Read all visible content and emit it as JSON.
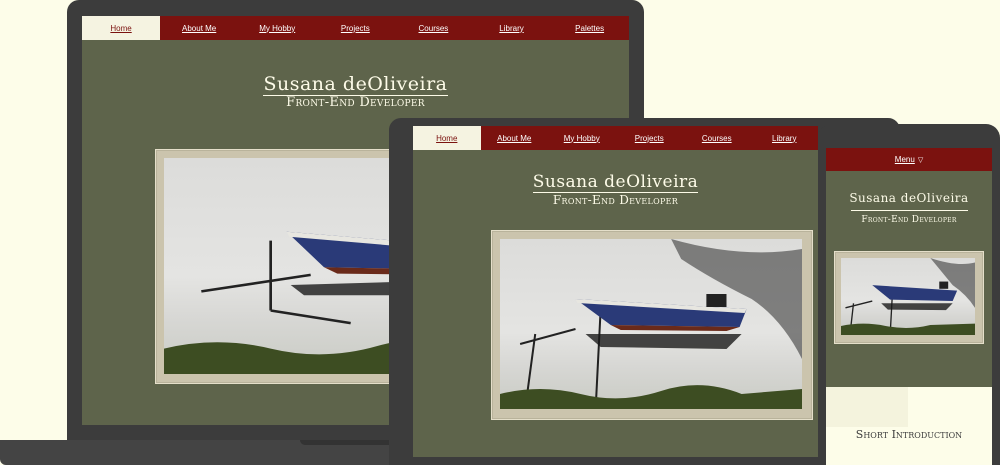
{
  "nav": {
    "items": [
      "Home",
      "About Me",
      "My Hobby",
      "Projects",
      "Courses",
      "Library",
      "Palettes"
    ],
    "active": "Home"
  },
  "header": {
    "name": "Susana deOliveira",
    "role": "Front-End Developer"
  },
  "mobile": {
    "menu_label": "Menu",
    "menu_icon": "triangle-down-icon",
    "section_title": "Short Introduction"
  },
  "colors": {
    "page_background": "#fdfde9",
    "nav": "#7b120f",
    "content_background": "#5e644b",
    "active_tab": "#f5f3e1",
    "device": "#3c3c3c"
  },
  "image": {
    "subject": "boat-photo"
  }
}
